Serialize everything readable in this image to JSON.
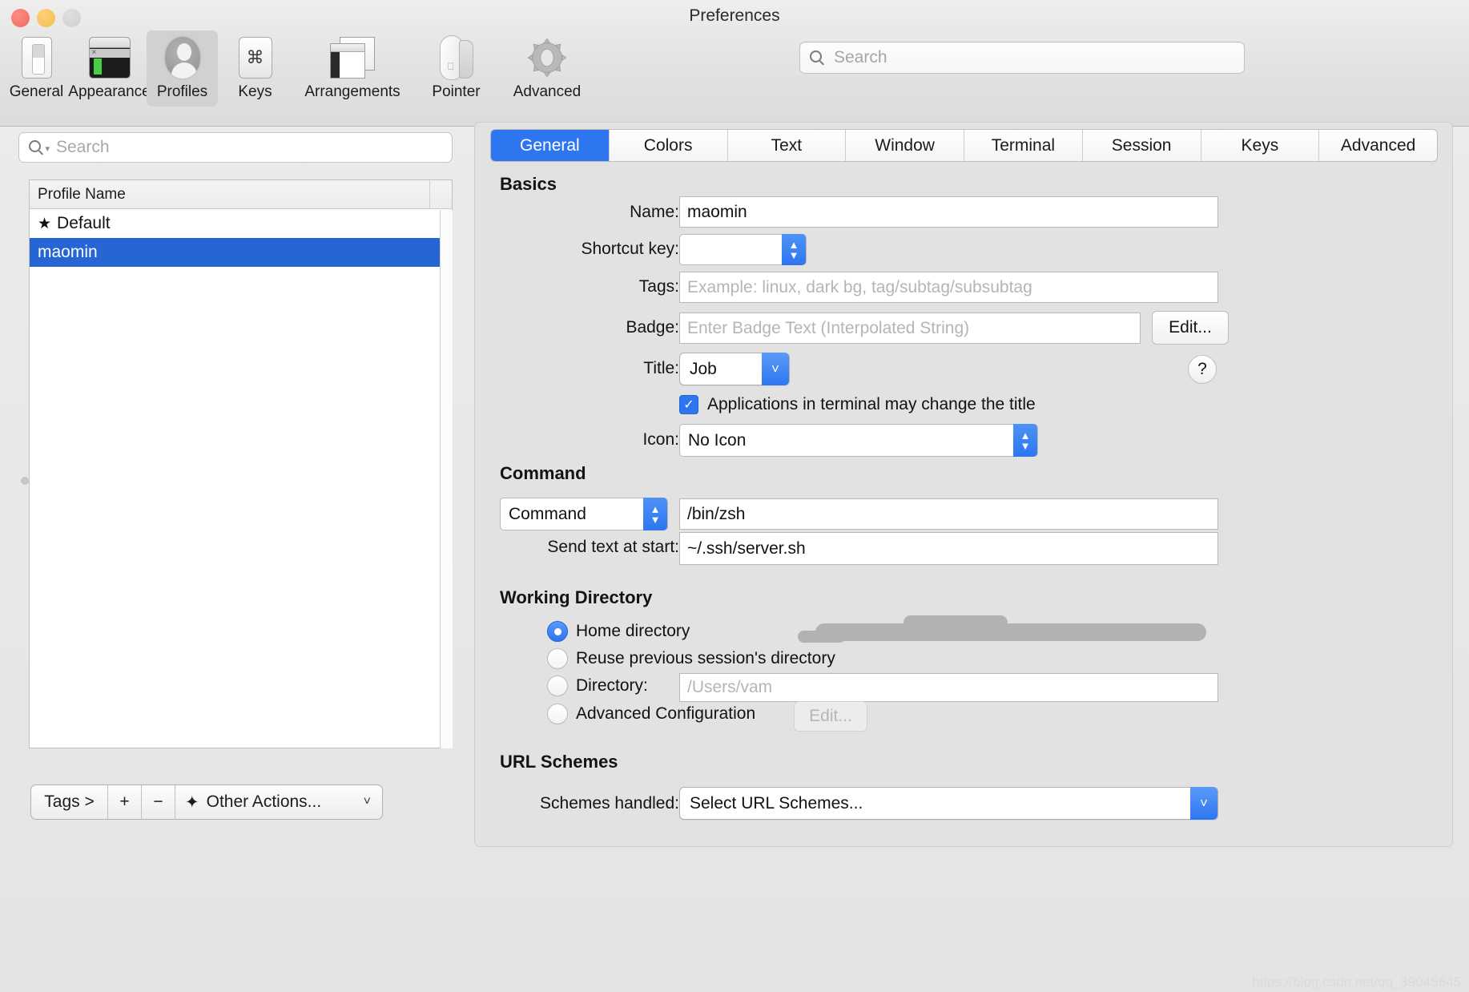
{
  "window": {
    "title": "Preferences",
    "traffic_lights": [
      "close",
      "minimize",
      "zoom"
    ]
  },
  "toolbar": {
    "items": [
      {
        "label": "General",
        "icon": "general-switch-icon",
        "selected": false
      },
      {
        "label": "Appearance",
        "icon": "appearance-terminal-icon",
        "selected": false
      },
      {
        "label": "Profiles",
        "icon": "profiles-person-icon",
        "selected": true
      },
      {
        "label": "Keys",
        "icon": "keys-command-key-icon",
        "selected": false
      },
      {
        "label": "Arrangements",
        "icon": "arrangements-windows-icon",
        "selected": false
      },
      {
        "label": "Pointer",
        "icon": "pointer-mouse-icon",
        "selected": false
      },
      {
        "label": "Advanced",
        "icon": "advanced-gear-icon",
        "selected": false
      }
    ],
    "search_placeholder": "Search",
    "search_value": "",
    "search_icon": "search-icon"
  },
  "sidebar": {
    "search_placeholder": "Search",
    "search_value": "",
    "search_icon": "search-icon",
    "table": {
      "column_header": "Profile Name",
      "rows": [
        {
          "star": "★",
          "name": "Default",
          "selected": false
        },
        {
          "star": "",
          "name": "maomin",
          "selected": true
        }
      ]
    },
    "actions": {
      "tags_label": "Tags >",
      "add_label": "+",
      "remove_label": "−",
      "other_actions_label": "Other Actions...",
      "other_actions_icon": "gear-icon",
      "chevron_icon": "chevron-down-icon"
    }
  },
  "tabs": [
    {
      "label": "General",
      "active": true
    },
    {
      "label": "Colors",
      "active": false
    },
    {
      "label": "Text",
      "active": false
    },
    {
      "label": "Window",
      "active": false
    },
    {
      "label": "Terminal",
      "active": false
    },
    {
      "label": "Session",
      "active": false
    },
    {
      "label": "Keys",
      "active": false
    },
    {
      "label": "Advanced",
      "active": false
    }
  ],
  "general": {
    "basics": {
      "heading": "Basics",
      "name_label": "Name:",
      "name_value": "maomin",
      "shortcut_label": "Shortcut key:",
      "shortcut_value": "",
      "tags_label": "Tags:",
      "tags_value": "",
      "tags_placeholder": "Example: linux, dark bg, tag/subtag/subsubtag",
      "badge_label": "Badge:",
      "badge_value": "",
      "badge_placeholder": "Enter Badge Text (Interpolated String)",
      "badge_edit_label": "Edit...",
      "title_label": "Title:",
      "title_value": "Job",
      "help_label": "?",
      "app_title_checkbox_label": "Applications in terminal may change the title",
      "app_title_checked": true,
      "icon_label": "Icon:",
      "icon_value": "No Icon"
    },
    "command": {
      "heading": "Command",
      "mode_value": "Command",
      "command_value": "/bin/zsh",
      "send_text_label": "Send text at start:",
      "send_text_value": "~/.ssh/server.sh",
      "send_text_redacted": true
    },
    "working_directory": {
      "heading": "Working Directory",
      "options": [
        {
          "label": "Home directory",
          "selected": true
        },
        {
          "label": "Reuse previous session's directory",
          "selected": false
        },
        {
          "label": "Directory:",
          "selected": false
        },
        {
          "label": "Advanced Configuration",
          "selected": false
        }
      ],
      "directory_placeholder": "/Users/vam",
      "directory_value": "",
      "advanced_edit_label": "Edit...",
      "advanced_edit_disabled": true
    },
    "url_schemes": {
      "heading": "URL Schemes",
      "schemes_label": "Schemes handled:",
      "schemes_value": "Select URL Schemes..."
    }
  },
  "watermark": "https://blog.csdn.net/qq_39045645",
  "colors": {
    "accent_blue": "#2d76f0",
    "selection_blue": "#2566d4",
    "window_bg": "#ececec",
    "panel_bg": "#e2e2e2"
  }
}
